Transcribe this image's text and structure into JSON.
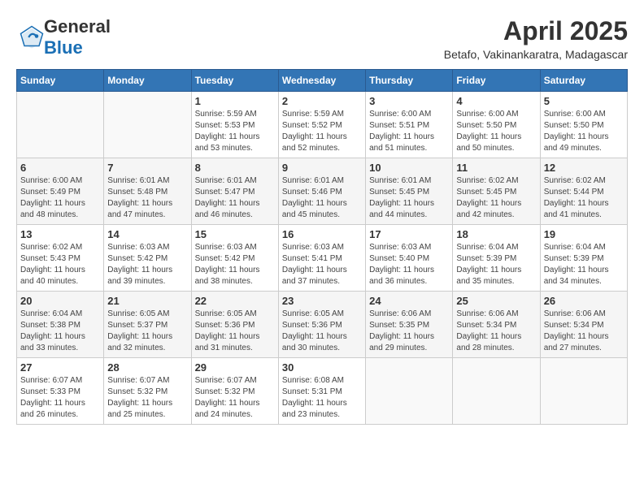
{
  "header": {
    "logo_general": "General",
    "logo_blue": "Blue",
    "month_title": "April 2025",
    "location": "Betafo, Vakinankaratra, Madagascar"
  },
  "weekdays": [
    "Sunday",
    "Monday",
    "Tuesday",
    "Wednesday",
    "Thursday",
    "Friday",
    "Saturday"
  ],
  "weeks": [
    [
      {
        "day": "",
        "info": ""
      },
      {
        "day": "",
        "info": ""
      },
      {
        "day": "1",
        "info": "Sunrise: 5:59 AM\nSunset: 5:53 PM\nDaylight: 11 hours and 53 minutes."
      },
      {
        "day": "2",
        "info": "Sunrise: 5:59 AM\nSunset: 5:52 PM\nDaylight: 11 hours and 52 minutes."
      },
      {
        "day": "3",
        "info": "Sunrise: 6:00 AM\nSunset: 5:51 PM\nDaylight: 11 hours and 51 minutes."
      },
      {
        "day": "4",
        "info": "Sunrise: 6:00 AM\nSunset: 5:50 PM\nDaylight: 11 hours and 50 minutes."
      },
      {
        "day": "5",
        "info": "Sunrise: 6:00 AM\nSunset: 5:50 PM\nDaylight: 11 hours and 49 minutes."
      }
    ],
    [
      {
        "day": "6",
        "info": "Sunrise: 6:00 AM\nSunset: 5:49 PM\nDaylight: 11 hours and 48 minutes."
      },
      {
        "day": "7",
        "info": "Sunrise: 6:01 AM\nSunset: 5:48 PM\nDaylight: 11 hours and 47 minutes."
      },
      {
        "day": "8",
        "info": "Sunrise: 6:01 AM\nSunset: 5:47 PM\nDaylight: 11 hours and 46 minutes."
      },
      {
        "day": "9",
        "info": "Sunrise: 6:01 AM\nSunset: 5:46 PM\nDaylight: 11 hours and 45 minutes."
      },
      {
        "day": "10",
        "info": "Sunrise: 6:01 AM\nSunset: 5:45 PM\nDaylight: 11 hours and 44 minutes."
      },
      {
        "day": "11",
        "info": "Sunrise: 6:02 AM\nSunset: 5:45 PM\nDaylight: 11 hours and 42 minutes."
      },
      {
        "day": "12",
        "info": "Sunrise: 6:02 AM\nSunset: 5:44 PM\nDaylight: 11 hours and 41 minutes."
      }
    ],
    [
      {
        "day": "13",
        "info": "Sunrise: 6:02 AM\nSunset: 5:43 PM\nDaylight: 11 hours and 40 minutes."
      },
      {
        "day": "14",
        "info": "Sunrise: 6:03 AM\nSunset: 5:42 PM\nDaylight: 11 hours and 39 minutes."
      },
      {
        "day": "15",
        "info": "Sunrise: 6:03 AM\nSunset: 5:42 PM\nDaylight: 11 hours and 38 minutes."
      },
      {
        "day": "16",
        "info": "Sunrise: 6:03 AM\nSunset: 5:41 PM\nDaylight: 11 hours and 37 minutes."
      },
      {
        "day": "17",
        "info": "Sunrise: 6:03 AM\nSunset: 5:40 PM\nDaylight: 11 hours and 36 minutes."
      },
      {
        "day": "18",
        "info": "Sunrise: 6:04 AM\nSunset: 5:39 PM\nDaylight: 11 hours and 35 minutes."
      },
      {
        "day": "19",
        "info": "Sunrise: 6:04 AM\nSunset: 5:39 PM\nDaylight: 11 hours and 34 minutes."
      }
    ],
    [
      {
        "day": "20",
        "info": "Sunrise: 6:04 AM\nSunset: 5:38 PM\nDaylight: 11 hours and 33 minutes."
      },
      {
        "day": "21",
        "info": "Sunrise: 6:05 AM\nSunset: 5:37 PM\nDaylight: 11 hours and 32 minutes."
      },
      {
        "day": "22",
        "info": "Sunrise: 6:05 AM\nSunset: 5:36 PM\nDaylight: 11 hours and 31 minutes."
      },
      {
        "day": "23",
        "info": "Sunrise: 6:05 AM\nSunset: 5:36 PM\nDaylight: 11 hours and 30 minutes."
      },
      {
        "day": "24",
        "info": "Sunrise: 6:06 AM\nSunset: 5:35 PM\nDaylight: 11 hours and 29 minutes."
      },
      {
        "day": "25",
        "info": "Sunrise: 6:06 AM\nSunset: 5:34 PM\nDaylight: 11 hours and 28 minutes."
      },
      {
        "day": "26",
        "info": "Sunrise: 6:06 AM\nSunset: 5:34 PM\nDaylight: 11 hours and 27 minutes."
      }
    ],
    [
      {
        "day": "27",
        "info": "Sunrise: 6:07 AM\nSunset: 5:33 PM\nDaylight: 11 hours and 26 minutes."
      },
      {
        "day": "28",
        "info": "Sunrise: 6:07 AM\nSunset: 5:32 PM\nDaylight: 11 hours and 25 minutes."
      },
      {
        "day": "29",
        "info": "Sunrise: 6:07 AM\nSunset: 5:32 PM\nDaylight: 11 hours and 24 minutes."
      },
      {
        "day": "30",
        "info": "Sunrise: 6:08 AM\nSunset: 5:31 PM\nDaylight: 11 hours and 23 minutes."
      },
      {
        "day": "",
        "info": ""
      },
      {
        "day": "",
        "info": ""
      },
      {
        "day": "",
        "info": ""
      }
    ]
  ]
}
